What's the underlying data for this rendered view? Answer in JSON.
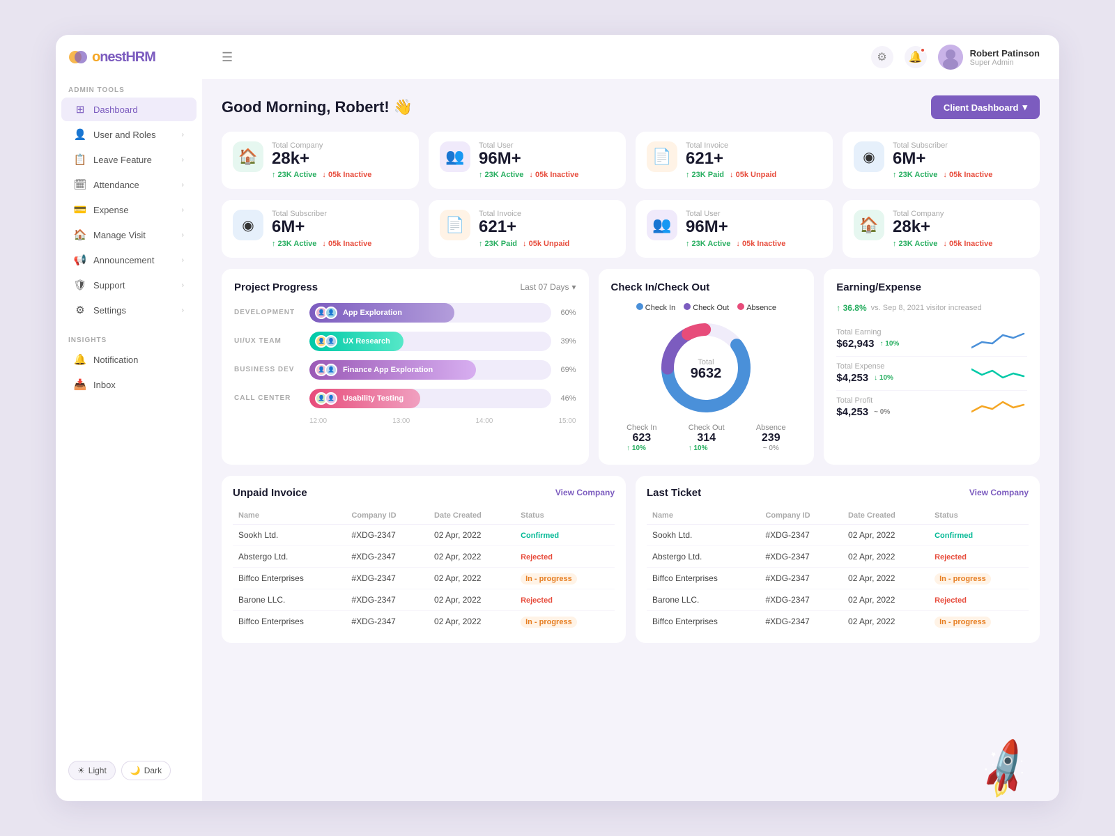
{
  "app": {
    "name": "onestHRM",
    "logo_o": "o",
    "logo_nest": "nest",
    "logo_hrm": "HRM"
  },
  "topbar": {
    "user_name": "Robert Patinson",
    "user_role": "Super Admin"
  },
  "greeting": "Good Morning, Robert! 👋",
  "client_dashboard_btn": "Client Dashboard",
  "sidebar": {
    "admin_tools_label": "ADMIN TOOLS",
    "insights_label": "INSIGHTS",
    "items": [
      {
        "id": "dashboard",
        "label": "Dashboard",
        "icon": "⊞",
        "hasChevron": false
      },
      {
        "id": "user-roles",
        "label": "User and Roles",
        "icon": "👤",
        "hasChevron": true
      },
      {
        "id": "leave",
        "label": "Leave Feature",
        "icon": "📋",
        "hasChevron": true
      },
      {
        "id": "attendance",
        "label": "Attendance",
        "icon": "🗓",
        "hasChevron": true
      },
      {
        "id": "expense",
        "label": "Expense",
        "icon": "💳",
        "hasChevron": true
      },
      {
        "id": "manage-visit",
        "label": "Manage Visit",
        "icon": "🏠",
        "hasChevron": true
      },
      {
        "id": "announcement",
        "label": "Announcement",
        "icon": "📢",
        "hasChevron": true
      },
      {
        "id": "support",
        "label": "Support",
        "icon": "🛡",
        "hasChevron": true
      },
      {
        "id": "settings",
        "label": "Settings",
        "icon": "⚙",
        "hasChevron": true
      }
    ],
    "insight_items": [
      {
        "id": "notification",
        "label": "Notification",
        "icon": "🔔"
      },
      {
        "id": "inbox",
        "label": "Inbox",
        "icon": "📥"
      }
    ],
    "theme": {
      "light": "Light",
      "dark": "Dark"
    }
  },
  "stats_row1": [
    {
      "id": "total-company",
      "label": "Total Company",
      "value": "28k+",
      "icon": "🏠",
      "icon_class": "stat-icon-green",
      "badge_up_val": "23K",
      "badge_up_label": "Active",
      "badge_down_val": "05k",
      "badge_down_label": "Inactive"
    },
    {
      "id": "total-user",
      "label": "Total User",
      "value": "96M+",
      "icon": "👥",
      "icon_class": "stat-icon-purple",
      "badge_up_val": "23K",
      "badge_up_label": "Active",
      "badge_down_val": "05k",
      "badge_down_label": "Inactive"
    },
    {
      "id": "total-invoice",
      "label": "Total Invoice",
      "value": "621+",
      "icon": "📄",
      "icon_class": "stat-icon-orange",
      "badge_up_val": "23K",
      "badge_up_label": "Paid",
      "badge_down_val": "05k",
      "badge_down_label": "Unpaid"
    },
    {
      "id": "total-subscriber",
      "label": "Total Subscriber",
      "value": "6M+",
      "icon": "🔵",
      "icon_class": "stat-icon-blue",
      "badge_up_val": "23K",
      "badge_up_label": "Active",
      "badge_down_val": "05k",
      "badge_down_label": "Inactive"
    }
  ],
  "stats_row2": [
    {
      "id": "total-subscriber2",
      "label": "Total Subscriber",
      "value": "6M+",
      "icon": "🔵",
      "icon_class": "stat-icon-blue",
      "badge_up_val": "23K",
      "badge_up_label": "Active",
      "badge_down_val": "05k",
      "badge_down_label": "Inactive"
    },
    {
      "id": "total-invoice2",
      "label": "Total Invoice",
      "value": "621+",
      "icon": "📄",
      "icon_class": "stat-icon-orange",
      "badge_up_val": "23K",
      "badge_up_label": "Paid",
      "badge_down_val": "05k",
      "badge_down_label": "Unpaid"
    },
    {
      "id": "total-user2",
      "label": "Total User",
      "value": "96M+",
      "icon": "👥",
      "icon_class": "stat-icon-purple",
      "badge_up_val": "23K",
      "badge_up_label": "Active",
      "badge_down_val": "05k",
      "badge_down_label": "Inactive"
    },
    {
      "id": "total-company2",
      "label": "Total Company",
      "value": "28k+",
      "icon": "🏠",
      "icon_class": "stat-icon-green",
      "badge_up_val": "23K",
      "badge_up_label": "Active",
      "badge_down_val": "05k",
      "badge_down_label": "Inactive"
    }
  ],
  "project_progress": {
    "title": "Project Progress",
    "filter": "Last 07 Days",
    "rows": [
      {
        "label": "DEVELOPMENT",
        "task": "App Exploration",
        "pct": 60,
        "color": "#7c5cbf",
        "bg": "#e8e0f7"
      },
      {
        "label": "UI/UX TEAM",
        "task": "UX Research",
        "pct": 39,
        "color": "#00c9a7",
        "bg": "#e0f7f3"
      },
      {
        "label": "BUSINESS DEV",
        "task": "Finance App Exploration",
        "pct": 69,
        "color": "#9b59b6",
        "bg": "#f3e6fb"
      },
      {
        "label": "CALL CENTER",
        "task": "Usability Testing",
        "pct": 46,
        "color": "#e74c7a",
        "bg": "#fde8ef"
      }
    ],
    "x_axis": [
      "12:00",
      "13:00",
      "14:00",
      "15:00"
    ]
  },
  "checkin_checkout": {
    "title": "Check In/Check Out",
    "legend": [
      {
        "label": "Check In",
        "color": "#4a90d9"
      },
      {
        "label": "Check Out",
        "color": "#7c5cbf"
      },
      {
        "label": "Absence",
        "color": "#e74c7a"
      }
    ],
    "total_label": "Total",
    "total_value": "9632",
    "stats": [
      {
        "label": "Check In",
        "value": "623",
        "badge": "↑ 10%",
        "badge_color": "#27ae60"
      },
      {
        "label": "Check Out",
        "value": "314",
        "badge": "↑ 10%",
        "badge_color": "#27ae60"
      },
      {
        "label": "Absence",
        "value": "239",
        "badge": "~ 0%",
        "badge_color": "#888"
      }
    ]
  },
  "earning_expense": {
    "title": "Earning/Expense",
    "increase_pct": "36.8%",
    "increase_label": "vs. Sep 8, 2021 visitor increased",
    "items": [
      {
        "label": "Total Earning",
        "value": "$62,943",
        "badge": "↑ 10%",
        "badge_color": "#27ae60",
        "line_color": "#4a90d9"
      },
      {
        "label": "Total Expense",
        "value": "$4,253",
        "badge": "↓ 10%",
        "badge_color": "#27ae60",
        "line_color": "#00c9a7"
      },
      {
        "label": "Total Profit",
        "value": "$4,253",
        "badge": "~ 0%",
        "badge_color": "#888",
        "line_color": "#f5a623"
      }
    ]
  },
  "unpaid_invoice": {
    "title": "Unpaid Invoice",
    "view_label": "View Company",
    "columns": [
      "Name",
      "Company ID",
      "Date Created",
      "Status"
    ],
    "rows": [
      {
        "name": "Sookh Ltd.",
        "company_id": "#XDG-2347",
        "date": "02 Apr, 2022",
        "status": "Confirmed",
        "status_class": "confirmed"
      },
      {
        "name": "Abstergo Ltd.",
        "company_id": "#XDG-2347",
        "date": "02 Apr, 2022",
        "status": "Rejected",
        "status_class": "rejected"
      },
      {
        "name": "Biffco Enterprises",
        "company_id": "#XDG-2347",
        "date": "02 Apr, 2022",
        "status": "In - progress",
        "status_class": "inprogress"
      },
      {
        "name": "Barone LLC.",
        "company_id": "#XDG-2347",
        "date": "02 Apr, 2022",
        "status": "Rejected",
        "status_class": "rejected"
      },
      {
        "name": "Biffco Enterprises",
        "company_id": "#XDG-2347",
        "date": "02 Apr, 2022",
        "status": "In - progress",
        "status_class": "inprogress"
      }
    ]
  },
  "last_ticket": {
    "title": "Last Ticket",
    "view_label": "View Company",
    "columns": [
      "Name",
      "Company ID",
      "Date Created",
      "Status"
    ],
    "rows": [
      {
        "name": "Sookh Ltd.",
        "company_id": "#XDG-2347",
        "date": "02 Apr, 2022",
        "status": "Confirmed",
        "status_class": "confirmed"
      },
      {
        "name": "Abstergo Ltd.",
        "company_id": "#XDG-2347",
        "date": "02 Apr, 2022",
        "status": "Rejected",
        "status_class": "rejected"
      },
      {
        "name": "Biffco Enterprises",
        "company_id": "#XDG-2347",
        "date": "02 Apr, 2022",
        "status": "In - progress",
        "status_class": "inprogress"
      },
      {
        "name": "Barone LLC.",
        "company_id": "#XDG-2347",
        "date": "02 Apr, 2022",
        "status": "Rejected",
        "status_class": "rejected"
      },
      {
        "name": "Biffco Enterprises",
        "company_id": "#XDG-2347",
        "date": "02 Apr, 2022",
        "status": "In - progress",
        "status_class": "inprogress"
      }
    ]
  }
}
